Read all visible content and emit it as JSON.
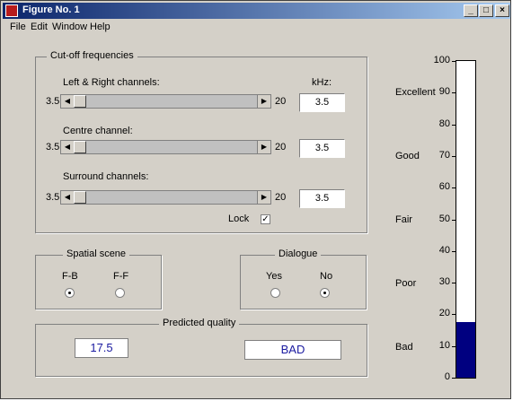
{
  "window": {
    "title": "Figure No. 1",
    "min": "_",
    "max": "□",
    "close": "×"
  },
  "menu": {
    "file": "File",
    "edit": "Edit",
    "window": "Window",
    "help": "Help"
  },
  "cutoff": {
    "title": "Cut-off frequencies",
    "khz_label": "kHz:",
    "left_right": {
      "label": "Left & Right channels:",
      "min": "3.5",
      "max": "20",
      "value": "3.5"
    },
    "centre": {
      "label": "Centre channel:",
      "min": "3.5",
      "max": "20",
      "value": "3.5"
    },
    "surround": {
      "label": "Surround channels:",
      "min": "3.5",
      "max": "20",
      "value": "3.5"
    },
    "lock_label": "Lock",
    "lock_checked": "✓"
  },
  "spatial": {
    "title": "Spatial scene",
    "fb": "F-B",
    "ff": "F-F",
    "selected": "F-B"
  },
  "dialogue": {
    "title": "Dialogue",
    "yes": "Yes",
    "no": "No",
    "selected": "No"
  },
  "predicted": {
    "title": "Predicted quality",
    "value": "17.5",
    "grade": "BAD"
  },
  "quality_scale": {
    "labels": [
      "Excellent",
      "Good",
      "Fair",
      "Poor",
      "Bad"
    ],
    "ticks": [
      "100",
      "90",
      "80",
      "70",
      "60",
      "50",
      "40",
      "30",
      "20",
      "10",
      "0"
    ],
    "min": 0,
    "max": 100,
    "value": 17.5,
    "fill_color": "#000080"
  }
}
